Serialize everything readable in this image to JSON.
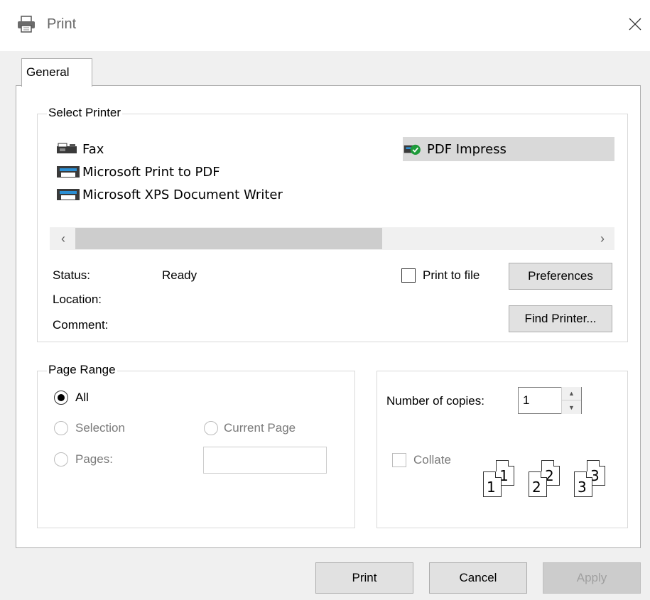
{
  "window": {
    "title": "Print",
    "close_icon": "close-icon"
  },
  "tabs": [
    {
      "label": "General",
      "selected": true
    }
  ],
  "select_printer": {
    "group_label": "Select Printer",
    "printers": [
      {
        "name": "Fax",
        "icon": "fax-icon"
      },
      {
        "name": "Microsoft Print to PDF",
        "icon": "printer-icon"
      },
      {
        "name": "Microsoft XPS Document Writer",
        "icon": "printer-icon"
      },
      {
        "name": "PDF Impress",
        "icon": "default-printer-icon",
        "selected": true
      }
    ],
    "status_label": "Status:",
    "status_value": "Ready",
    "location_label": "Location:",
    "location_value": "",
    "comment_label": "Comment:",
    "comment_value": "",
    "print_to_file_label": "Print to file",
    "print_to_file_checked": false,
    "preferences_label": "Preferences",
    "find_printer_label": "Find Printer..."
  },
  "page_range": {
    "group_label": "Page Range",
    "all_label": "All",
    "selection_label": "Selection",
    "current_page_label": "Current Page",
    "pages_label": "Pages:",
    "pages_value": "",
    "selected": "All"
  },
  "copies": {
    "label": "Number of copies:",
    "value": "1",
    "collate_label": "Collate",
    "collate_checked": false,
    "collate_pages": [
      "1",
      "1",
      "2",
      "2",
      "3",
      "3"
    ]
  },
  "footer": {
    "print_label": "Print",
    "cancel_label": "Cancel",
    "apply_label": "Apply",
    "apply_disabled": true
  }
}
